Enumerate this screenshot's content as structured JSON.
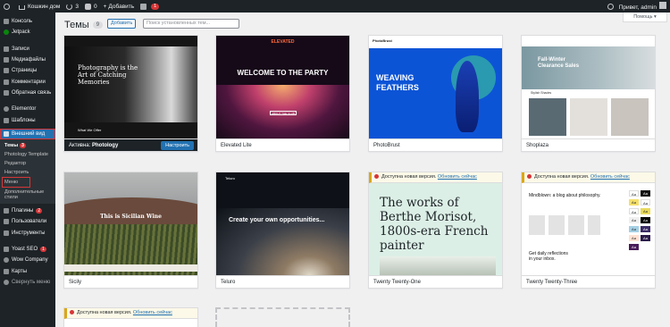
{
  "adminbar": {
    "site_name": "Кошкин дом",
    "updates_count": "3",
    "comments_count": "0",
    "new_label": "Добавить",
    "notifications_count": "1",
    "greeting": "Привет, admin"
  },
  "sidebar": {
    "items": [
      {
        "label": "Консоль",
        "icon": "dashboard-icon"
      },
      {
        "label": "Jetpack",
        "icon": "jetpack-icon"
      },
      {
        "label": "Записи",
        "icon": "pin-icon"
      },
      {
        "label": "Медиафайлы",
        "icon": "media-icon"
      },
      {
        "label": "Страницы",
        "icon": "page-icon"
      },
      {
        "label": "Комментарии",
        "icon": "comment-icon"
      },
      {
        "label": "Обратная связь",
        "icon": "feedback-icon"
      },
      {
        "label": "Elementor",
        "icon": "elementor-icon"
      },
      {
        "label": "Шаблоны",
        "icon": "templates-icon"
      },
      {
        "label": "Внешний вид",
        "icon": "brush-icon"
      }
    ],
    "submenu": [
      {
        "label": "Темы",
        "badge": "3"
      },
      {
        "label": "Photology Template"
      },
      {
        "label": "Редактор"
      },
      {
        "label": "Настроить"
      },
      {
        "label": "Меню"
      },
      {
        "label": "Дополнительные стили"
      }
    ],
    "items2": [
      {
        "label": "Плагины",
        "badge": "2",
        "icon": "plugin-icon"
      },
      {
        "label": "Пользователи",
        "icon": "users-icon"
      },
      {
        "label": "Инструменты",
        "icon": "tools-icon"
      },
      {
        "label": "Yoast SEO",
        "badge": "1",
        "icon": "yoast-icon"
      },
      {
        "label": "Wow Company",
        "icon": "wow-icon"
      },
      {
        "label": "Карты",
        "icon": "map-icon"
      },
      {
        "label": "Свернуть меню",
        "icon": "collapse-icon"
      }
    ]
  },
  "main": {
    "title": "Темы",
    "count": "9",
    "add_label": "Добавить",
    "search_placeholder": "Поиск установленных тем...",
    "help_label": "Помощь ▾",
    "active_prefix": "Активна:",
    "customize_label": "Настроить",
    "notice_text": "Доступна новая версия.",
    "notice_link": "Обновить сейчас"
  },
  "themes": [
    {
      "name": "Photology",
      "active": true,
      "screenshot": {
        "lines": [
          "Photography is the",
          "Art of Catching",
          "Memories"
        ],
        "small": "What We Offer"
      }
    },
    {
      "name": "Elevated Lite",
      "screenshot": {
        "logo": "ELEVATED",
        "title": "WELCOME TO THE PARTY",
        "button": "ABOUT THE CLUB"
      }
    },
    {
      "name": "PhotoBrust",
      "screenshot": {
        "logo": "PhotoBrust",
        "title": "WEAVING FEATHERS"
      }
    },
    {
      "name": "Shoplaza",
      "screenshot": {
        "title": "Fall-Winter Clearance Sales",
        "label": "Stylish Shades"
      }
    },
    {
      "name": "Sicily",
      "screenshot": {
        "title": "This is Sicilian Wine"
      }
    },
    {
      "name": "Teluro",
      "screenshot": {
        "logo": "Teluro",
        "title": "Create your own opportunities..."
      }
    },
    {
      "name": "Twenty Twenty-One",
      "update": true,
      "screenshot": {
        "title": "The works of Berthe Morisot, 1800s-era French painter"
      }
    },
    {
      "name": "Twenty Twenty-Three",
      "update": true,
      "screenshot": {
        "title": "Mindblown: a blog about philosophy.",
        "footer": "Get daily reflections in your inbox."
      }
    },
    {
      "name": "",
      "update": true
    }
  ],
  "colors": {
    "accent": "#2271b1",
    "adminbar": "#1d2327",
    "notice": "#dba617",
    "badge": "#d63638"
  }
}
